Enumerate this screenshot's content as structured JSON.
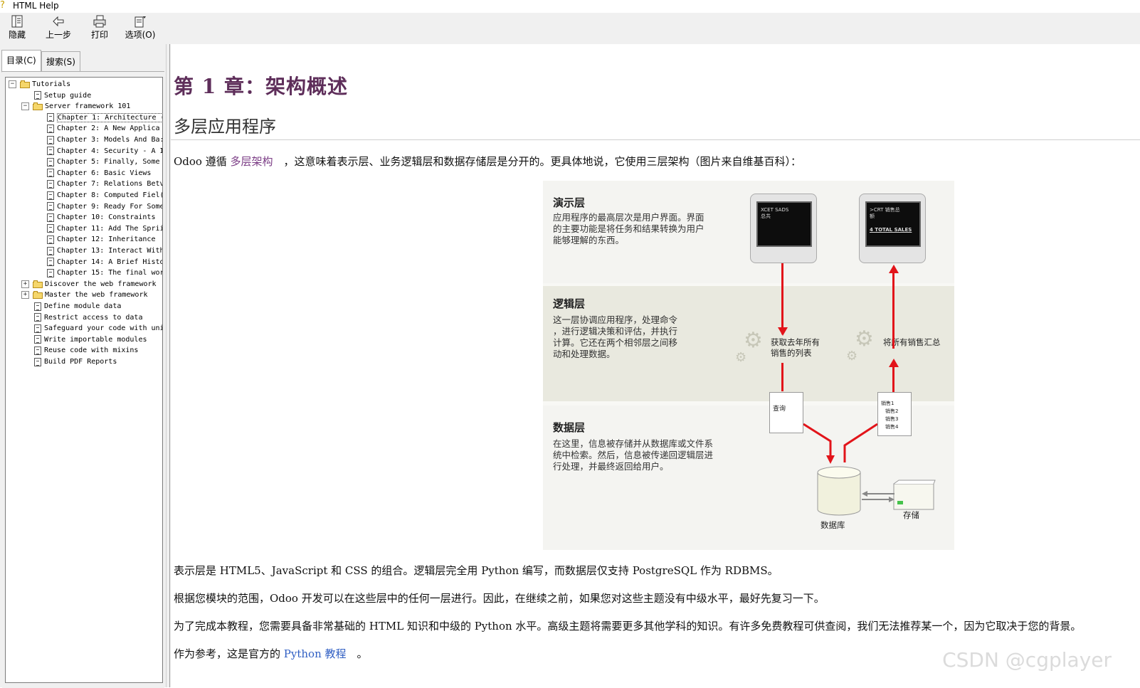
{
  "window": {
    "title": "HTML Help"
  },
  "toolbar": {
    "hide_label": "隐藏",
    "back_label": "上一步",
    "print_label": "打印",
    "options_label": "选项(O)"
  },
  "tabs": [
    {
      "label": "目录(C)"
    },
    {
      "label": "搜索(S)"
    }
  ],
  "toc": [
    {
      "label": "Tutorials"
    },
    {
      "label": "Setup guide"
    },
    {
      "label": "Server framework 101"
    },
    {
      "label": "Chapter 1: Architecture ("
    },
    {
      "label": "Chapter 2: A New Applica"
    },
    {
      "label": "Chapter 3: Models And Ba:"
    },
    {
      "label": "Chapter 4: Security - A I"
    },
    {
      "label": "Chapter 5: Finally, Some"
    },
    {
      "label": "Chapter 6: Basic Views"
    },
    {
      "label": "Chapter 7: Relations Betv"
    },
    {
      "label": "Chapter 8: Computed Fiel("
    },
    {
      "label": "Chapter 9: Ready For Some"
    },
    {
      "label": "Chapter 10: Constraints"
    },
    {
      "label": "Chapter 11: Add The Sprii"
    },
    {
      "label": "Chapter 12: Inheritance"
    },
    {
      "label": "Chapter 13: Interact With"
    },
    {
      "label": "Chapter 14: A Brief Histo"
    },
    {
      "label": "Chapter 15: The final wor"
    },
    {
      "label": "Discover the web framework"
    },
    {
      "label": "Master the web framework"
    },
    {
      "label": "Define module data"
    },
    {
      "label": "Restrict access to data"
    },
    {
      "label": "Safeguard your code with uni"
    },
    {
      "label": "Write importable modules"
    },
    {
      "label": "Reuse code with mixins"
    },
    {
      "label": "Build PDF Reports"
    }
  ],
  "content": {
    "h1": "第 1 章：架构概述",
    "h2": "多层应用程序",
    "p1_pre": "Odoo 遵循 ",
    "p1_link": "多层架构",
    "p1_post": "　，这意味着表示层、业务逻辑层和数据存储层是分开的。更具体地说，它使用三层架构（图片来自维基百科）：",
    "p2": "表示层是 HTML5、JavaScript 和 CSS 的组合。逻辑层完全用 Python 编写，而数据层仅支持 PostgreSQL 作为 RDBMS。",
    "p3": "根据您模块的范围，Odoo 开发可以在这些层中的任何一层进行。因此，在继续之前，如果您对这些主题没有中级水平，最好先复习一下。",
    "p4": "为了完成本教程，您需要具备非常基础的 HTML 知识和中级的 Python 水平。高级主题将需要更多其他学科的知识。有许多免费教程可供查阅，我们无法推荐某一个，因为它取决于您的背景。",
    "p5_pre": "作为参考，这是官方的 ",
    "p5_link": "Python 教程",
    "p5_post": "　。"
  },
  "diagram": {
    "presentation_title": "演示层",
    "presentation_desc": [
      "应用程序的最高层次是用户界面。界面",
      "的主要功能是将任务和结果转换为用户",
      "能够理解的东西。"
    ],
    "logic_title": "逻辑层",
    "logic_desc": [
      "这一层协调应用程序，处理命令",
      "，进行逻辑决策和评估，并执行",
      "计算。它还在两个相邻层之间移",
      "动和处理数据。"
    ],
    "data_title": "数据层",
    "data_desc": [
      "在这里，信息被存储并从数据库或文件系",
      "统中检索。然后，信息被传递回逻辑层进",
      "行处理，并最终返回给用户。"
    ],
    "screen1": [
      "XCET SADS",
      "总共"
    ],
    "screen2": [
      ">CRT 销售总",
      "额",
      "4 TOTAL SALES"
    ],
    "gear1_label": [
      "获取去年所有",
      "销售的列表"
    ],
    "gear2_label": "将所有销售汇总",
    "doc1": "查询",
    "doc2": [
      "销售1",
      "销售2",
      "销售3",
      "销售4"
    ],
    "db_label": "数据库",
    "storage_label": "存储"
  },
  "watermark": "CSDN @cgplayer"
}
